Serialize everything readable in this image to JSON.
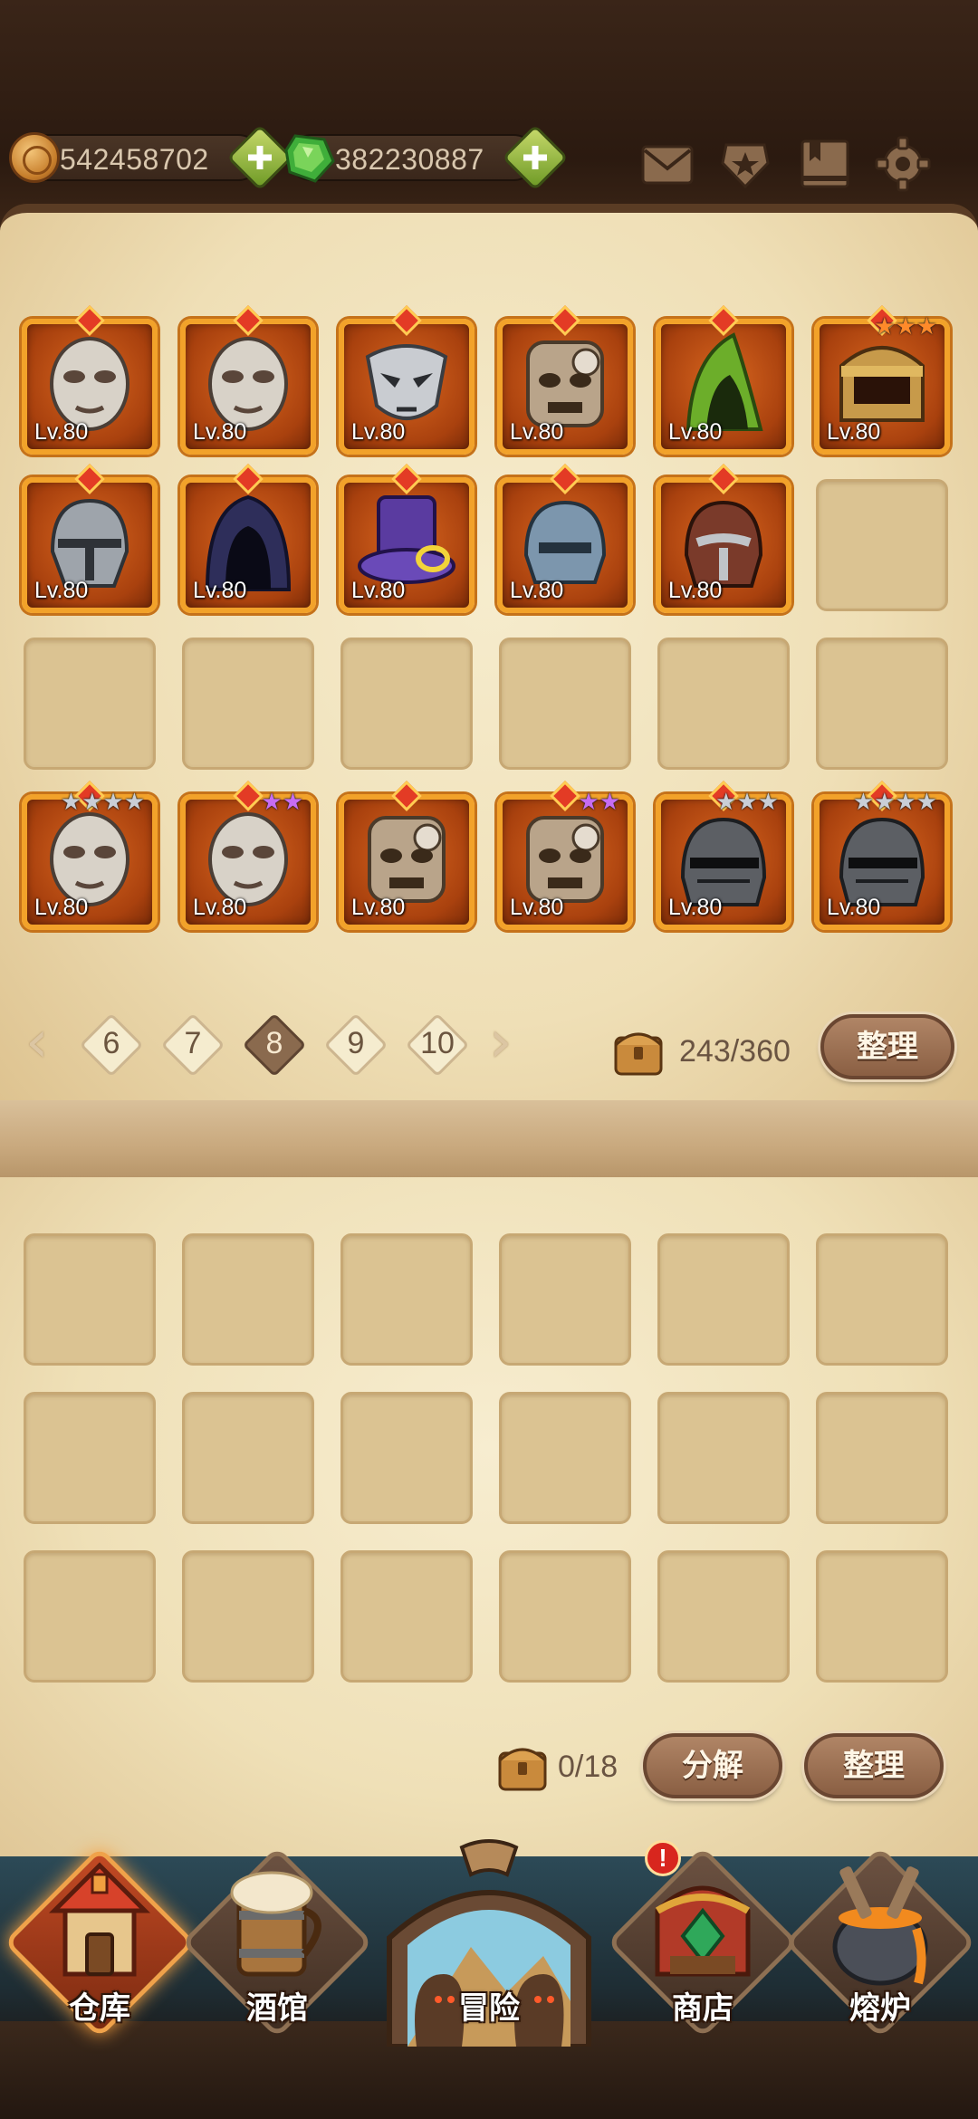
{
  "currencies": {
    "gold": {
      "value": "542458702",
      "icon": "gold-coin-icon"
    },
    "gem": {
      "value": "382230887",
      "icon": "green-gem-icon"
    }
  },
  "top_icons": [
    "mail-icon",
    "favorite-badge-icon",
    "bookmark-icon",
    "settings-gear-icon"
  ],
  "inventory": {
    "rows": [
      [
        {
          "level": "Lv.80",
          "art": "pale-mask"
        },
        {
          "level": "Lv.80",
          "art": "pale-mask"
        },
        {
          "level": "Lv.80",
          "art": "silver-mask"
        },
        {
          "level": "Lv.80",
          "art": "tribal-bone-mask"
        },
        {
          "level": "Lv.80",
          "art": "green-hood"
        },
        {
          "level": "Lv.80",
          "art": "gold-crown-helm",
          "stars": [
            "orange",
            "orange",
            "orange"
          ]
        }
      ],
      [
        {
          "level": "Lv.80",
          "art": "steel-helm"
        },
        {
          "level": "Lv.80",
          "art": "dark-blue-hood"
        },
        {
          "level": "Lv.80",
          "art": "purple-hat"
        },
        {
          "level": "Lv.80",
          "art": "blue-steel-helm"
        },
        {
          "level": "Lv.80",
          "art": "red-iron-helm"
        },
        null
      ],
      [
        null,
        null,
        null,
        null,
        null,
        null
      ],
      [
        {
          "level": "Lv.80",
          "art": "pale-mask",
          "stars": [
            "silver",
            "silver",
            "silver",
            "silver"
          ]
        },
        {
          "level": "Lv.80",
          "art": "pale-mask",
          "stars": [
            "purple",
            "purple"
          ]
        },
        {
          "level": "Lv.80",
          "art": "tribal-bone-mask"
        },
        {
          "level": "Lv.80",
          "art": "tribal-bone-mask",
          "stars": [
            "purple",
            "purple"
          ]
        },
        {
          "level": "Lv.80",
          "art": "black-knight-helm",
          "stars": [
            "silver",
            "silver",
            "silver"
          ]
        },
        {
          "level": "Lv.80",
          "art": "black-knight-helm",
          "stars": [
            "silver",
            "silver",
            "silver",
            "silver"
          ]
        }
      ]
    ],
    "pager": {
      "pages": [
        "6",
        "7",
        "8",
        "9",
        "10"
      ],
      "active": "8"
    },
    "capacity": "243/360",
    "sort_label": "整理"
  },
  "salvage": {
    "capacity": "0/18",
    "decompose_label": "分解",
    "sort_label": "整理"
  },
  "nav": [
    {
      "label": "仓库",
      "icon": "warehouse-icon",
      "active": true
    },
    {
      "label": "酒馆",
      "icon": "tavern-beer-icon",
      "active": false
    },
    {
      "label": "冒险",
      "icon": "adventure-icon",
      "active": false
    },
    {
      "label": "商店",
      "icon": "shop-icon",
      "active": false,
      "alert": "!"
    },
    {
      "label": "熔炉",
      "icon": "furnace-icon",
      "active": false
    }
  ],
  "colors": {
    "item_border": "#f2a22a",
    "item_bg": "#c1521a",
    "parchment": "#efdfb6",
    "empty_slot": "#dbc392"
  }
}
